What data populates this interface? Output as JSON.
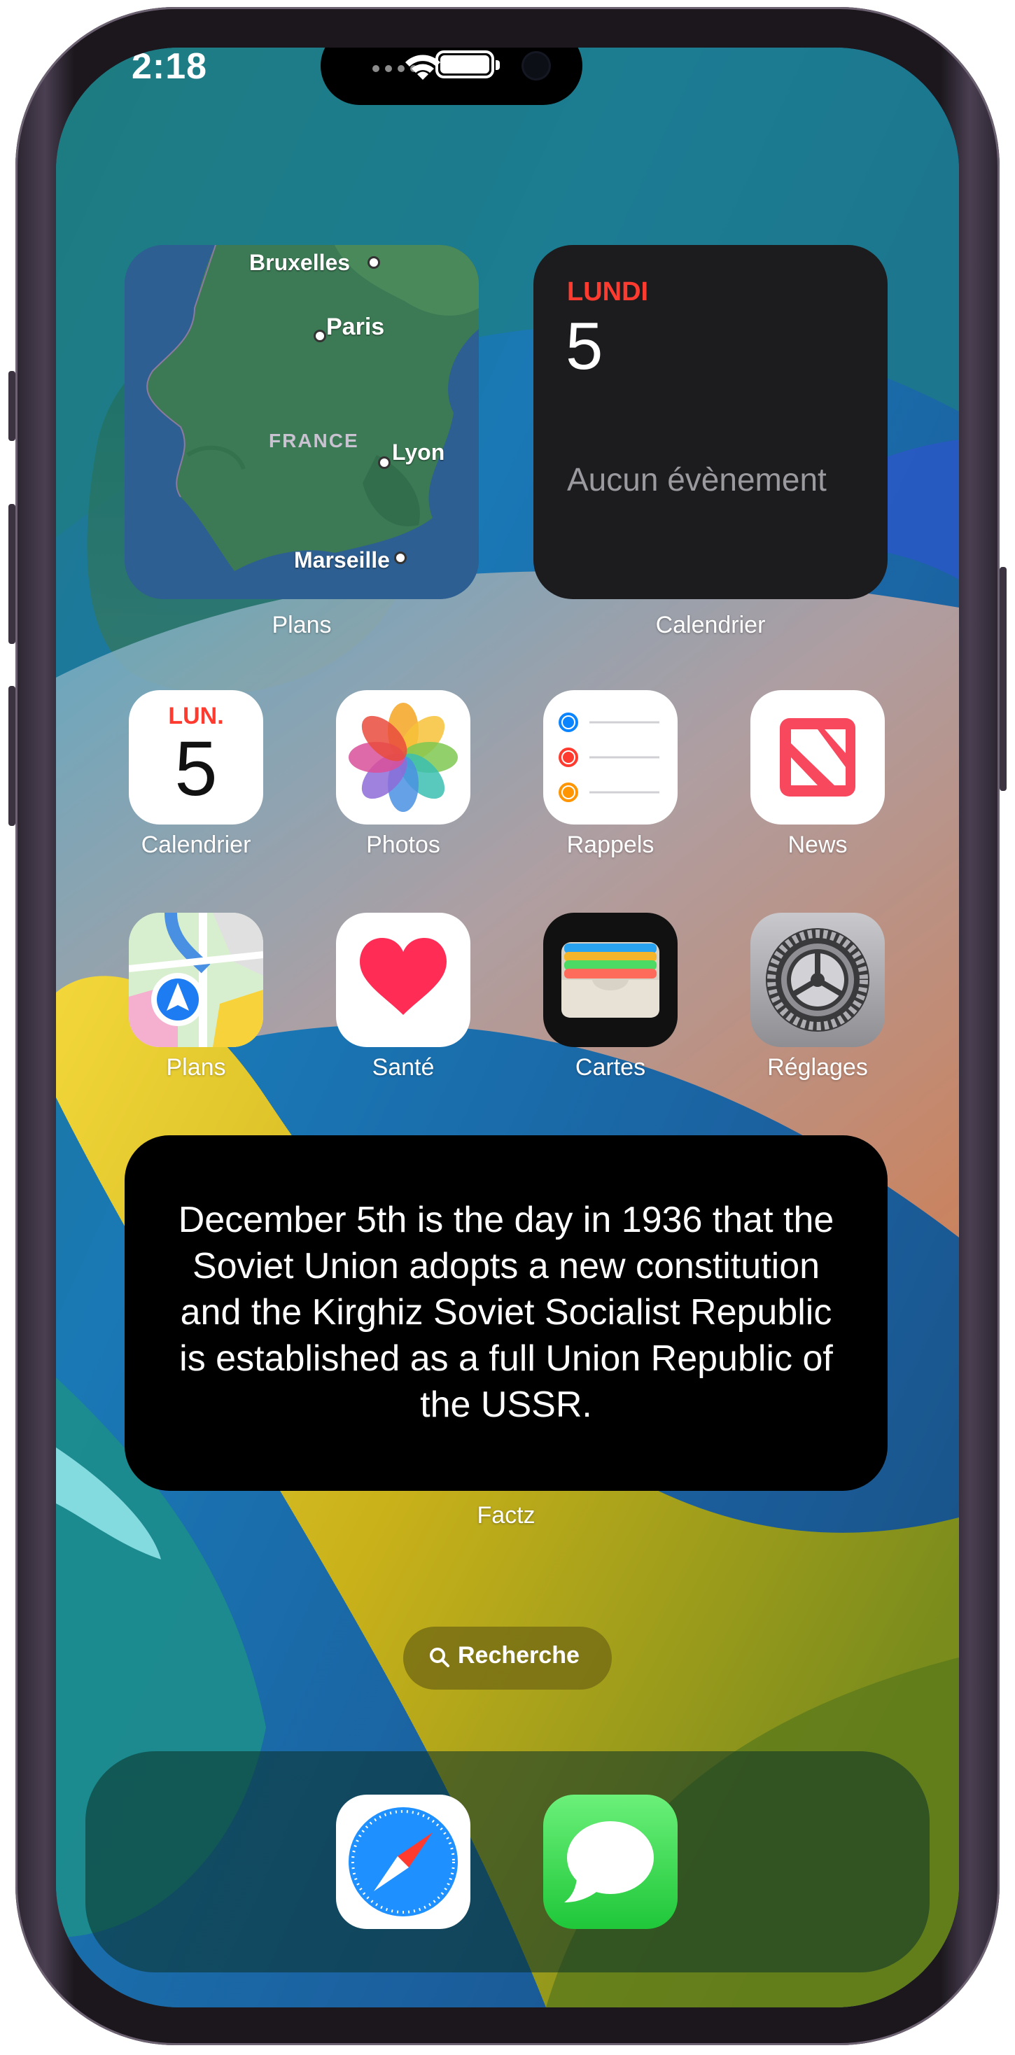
{
  "status": {
    "time": "2:18"
  },
  "widgets": {
    "map": {
      "label": "Plans",
      "cities": {
        "bruxelles": "Bruxelles",
        "paris": "Paris",
        "lyon": "Lyon",
        "marseille": "Marseille"
      },
      "country": "FRANCE"
    },
    "calendar": {
      "label": "Calendrier",
      "day": "LUNDI",
      "date": "5",
      "empty": "Aucun évènement"
    },
    "factz": {
      "label": "Factz",
      "text": "December 5th is the day in 1936 that the Soviet Union adopts a new constitution and the Kirghiz Soviet Socialist Republic is established as a full Union Republic of the USSR."
    }
  },
  "apps_row1": [
    {
      "label": "Calendrier",
      "icon": "calendar-icon",
      "day": "LUN.",
      "date": "5"
    },
    {
      "label": "Photos",
      "icon": "photos-icon"
    },
    {
      "label": "Rappels",
      "icon": "reminders-icon"
    },
    {
      "label": "News",
      "icon": "news-icon"
    }
  ],
  "apps_row2": [
    {
      "label": "Plans",
      "icon": "maps-icon"
    },
    {
      "label": "Santé",
      "icon": "health-icon"
    },
    {
      "label": "Cartes",
      "icon": "wallet-icon"
    },
    {
      "label": "Réglages",
      "icon": "settings-icon"
    }
  ],
  "search": {
    "label": "Recherche"
  },
  "dock": [
    {
      "icon": "safari-icon"
    },
    {
      "icon": "messages-icon"
    }
  ],
  "colors": {
    "calendar_red": "#ff3b30",
    "accent_blue": "#0a84ff",
    "dock_bg": "#0a3228"
  }
}
